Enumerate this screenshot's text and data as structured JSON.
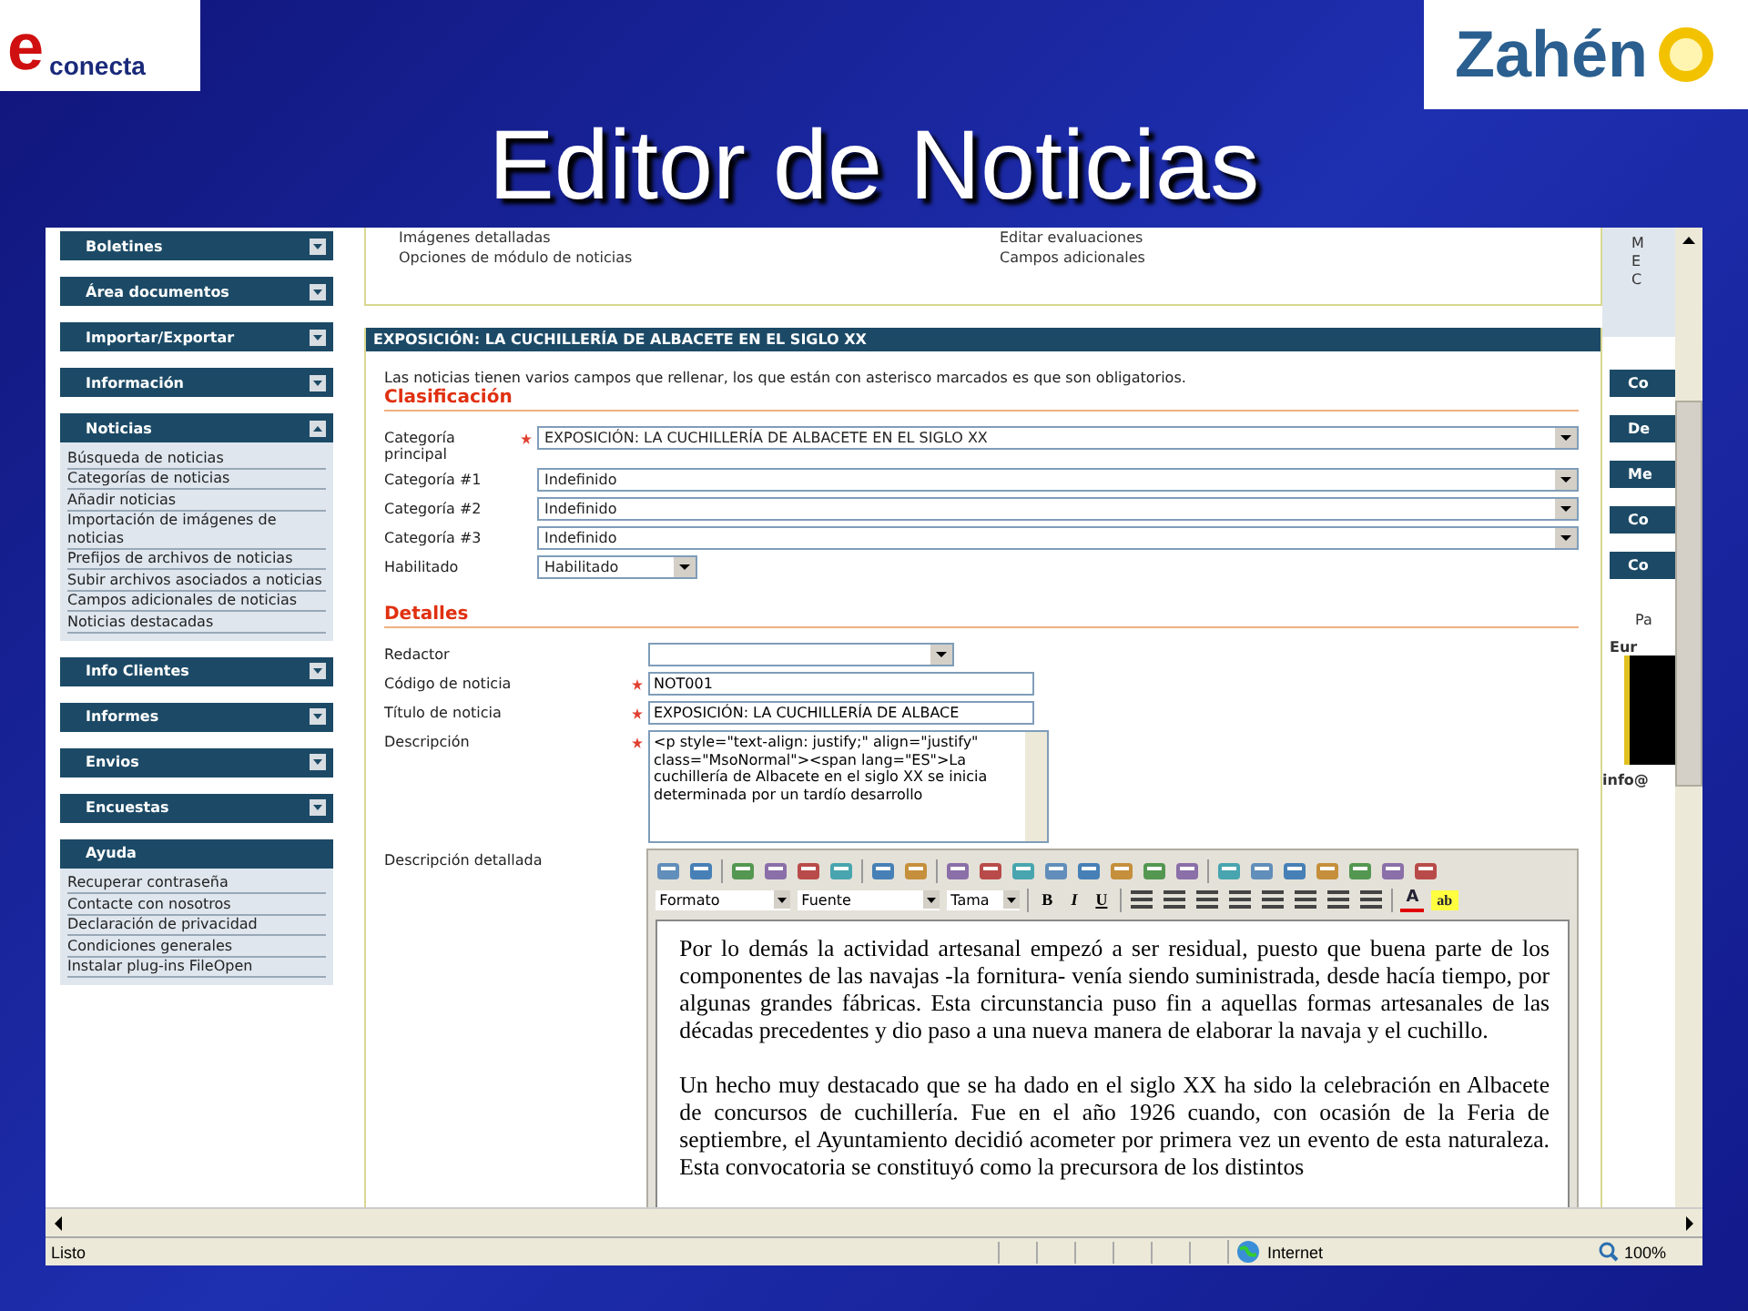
{
  "slide": {
    "title": "Editor de Noticias",
    "logo_left": {
      "letter": "e",
      "text": "conecta"
    },
    "logo_right": {
      "text": "Zahén"
    }
  },
  "sidebar": {
    "sections": [
      {
        "title": "Boletines",
        "kind": "collapsible",
        "expanded": false
      },
      {
        "title": "Área documentos",
        "kind": "collapsible",
        "expanded": false
      },
      {
        "title": "Importar/Exportar",
        "kind": "collapsible",
        "expanded": false
      },
      {
        "title": "Información",
        "kind": "collapsible",
        "expanded": false
      },
      {
        "title": "Noticias",
        "kind": "collapsible",
        "expanded": true,
        "items": [
          "Búsqueda de noticias",
          "Categorías de noticias",
          "Añadir noticias",
          "Importación de imágenes de noticias",
          "Prefijos de archivos de noticias",
          "Subir archivos asociados a noticias",
          "Campos adicionales de noticias",
          "Noticias destacadas"
        ]
      },
      {
        "title": "Info Clientes",
        "kind": "collapsible",
        "expanded": false
      },
      {
        "title": "Informes",
        "kind": "collapsible",
        "expanded": false
      },
      {
        "title": "Envios",
        "kind": "collapsible",
        "expanded": false
      },
      {
        "title": "Encuestas",
        "kind": "collapsible",
        "expanded": false
      },
      {
        "title": "Ayuda",
        "kind": "static",
        "items": [
          "Recuperar contraseña",
          "Contacte con nosotros",
          "Declaración de privacidad",
          "Condiciones generales",
          "Instalar plug-ins FileOpen"
        ]
      }
    ]
  },
  "top_links": {
    "left": [
      "Imágenes detalladas",
      "Opciones de módulo de noticias"
    ],
    "right": [
      "Editar evaluaciones",
      "Campos adicionales"
    ]
  },
  "panel": {
    "title": "EXPOSICIÓN: LA CUCHILLERÍA DE ALBACETE EN EL SIGLO XX",
    "intro": "Las noticias tienen varios campos que rellenar, los que están con asterisco marcados es que son obligatorios.",
    "sections": [
      {
        "heading": "Clasificación",
        "fields": [
          {
            "label": "Categoría principal",
            "required": true,
            "kind": "select",
            "value": "EXPOSICIÓN: LA CUCHILLERÍA DE ALBACETE EN EL SIGLO XX"
          },
          {
            "label": "Categoría #1",
            "required": false,
            "kind": "select",
            "value": "Indefinido"
          },
          {
            "label": "Categoría #2",
            "required": false,
            "kind": "select",
            "value": "Indefinido"
          },
          {
            "label": "Categoría #3",
            "required": false,
            "kind": "select",
            "value": "Indefinido"
          },
          {
            "label": "Habilitado",
            "required": false,
            "kind": "short-select",
            "value": "Habilitado"
          }
        ]
      },
      {
        "heading": "Detalles",
        "fields": [
          {
            "label": "Redactor",
            "required": false,
            "kind": "medium-select"
          },
          {
            "label": "Código de noticia",
            "required": true,
            "kind": "short-input",
            "value": "NOT001"
          },
          {
            "label": "Título de noticia",
            "required": true,
            "kind": "input",
            "value": "EXPOSICIÓN: LA CUCHILLERÍA DE ALBACE"
          },
          {
            "label": "Descripción",
            "required": true,
            "kind": "textarea",
            "value": "<p style=\"text-align: justify;\" align=\"justify\" class=\"MsoNormal\"><span lang=\"ES\">La cuchillería de Albacete en el siglo XX se inicia determinada por un tardío desarrollo"
          },
          {
            "label": "Descripción detallada",
            "required": false,
            "kind": "editor"
          }
        ]
      }
    ],
    "editor": {
      "dropdowns": [
        "Formato",
        "Fuente",
        "Tama"
      ],
      "format_buttons": [
        "B",
        "I",
        "U"
      ],
      "font_color": "A",
      "highlight": "ab",
      "paragraphs": [
        "Por lo demás la actividad artesanal empezó a ser residual, puesto que buena parte de los componentes de las navajas -la fornitura- venía siendo suministrada, desde hacía tiempo, por algunas grandes fábricas. Esta circunstancia puso fin a aquellas formas artesanales de las décadas precedentes y dio paso a una nueva manera de elaborar la navaja y el cuchillo.",
        "Un hecho muy destacado que se ha dado en el siglo XX ha sido la celebración en Albacete de concursos de cuchillería. Fue en el año 1926 cuando, con ocasión de la Feria de septiembre, el Ayuntamiento decidió acometer por primera vez un evento de esta naturaleza. Esta convocatoria se constituyó como la precursora de los distintos"
      ]
    }
  },
  "right_column": {
    "panel_letters": [
      "M",
      "E",
      "C"
    ],
    "buttons": [
      "Co",
      "De",
      "Me",
      "Co",
      "Co"
    ],
    "texts": [
      "Pa",
      "Eur"
    ],
    "email": "info@"
  },
  "status_bar": {
    "text": "Listo",
    "zone": "Internet",
    "zoom": "100%"
  }
}
